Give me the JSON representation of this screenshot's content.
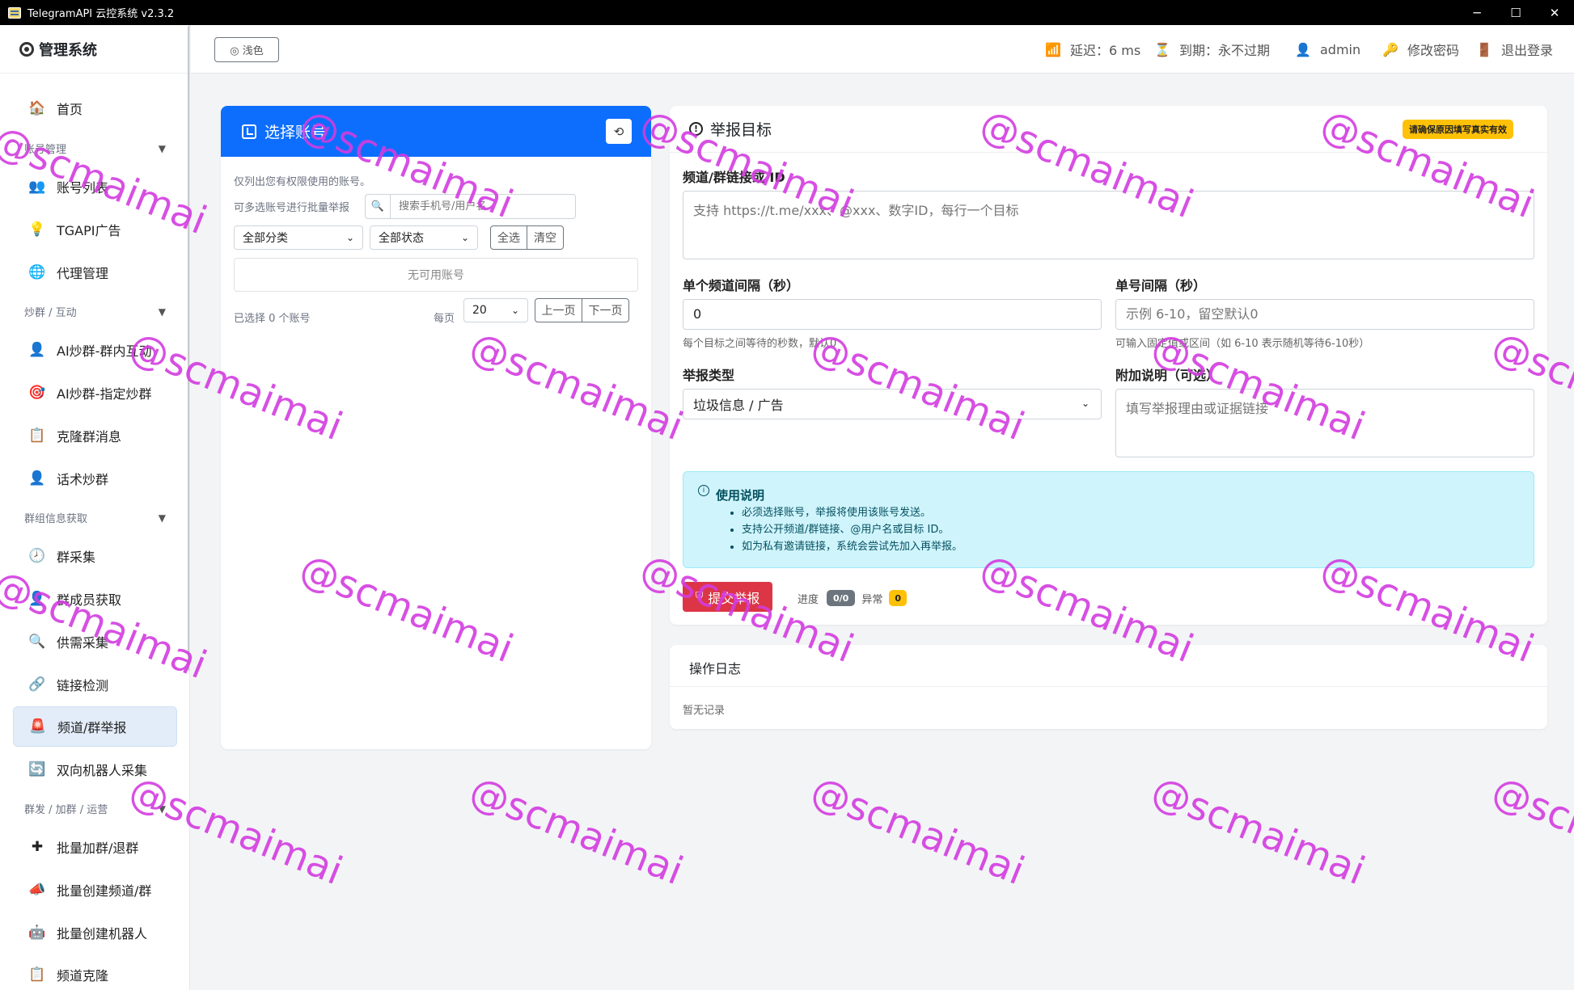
{
  "window": {
    "title": "TelegramAPI 云控系统 v2.3.2",
    "minimize": "─",
    "maximize": "☐",
    "close": "✕"
  },
  "sidebar": {
    "brand": "管理系统",
    "items": [
      {
        "label": "首页",
        "icon": "🏠"
      },
      {
        "label": "账号列表",
        "icon": "👥"
      },
      {
        "label": "TGAPI广告",
        "icon": "💡"
      },
      {
        "label": "代理管理",
        "icon": "🌐"
      },
      {
        "label": "AI炒群-群内互动",
        "icon": "👤"
      },
      {
        "label": "AI炒群-指定炒群",
        "icon": "🎯"
      },
      {
        "label": "克隆群消息",
        "icon": "📋"
      },
      {
        "label": "话术炒群",
        "icon": "👤"
      },
      {
        "label": "群采集",
        "icon": "🕗"
      },
      {
        "label": "群成员获取",
        "icon": "👤"
      },
      {
        "label": "供需采集",
        "icon": "🔍"
      },
      {
        "label": "链接检测",
        "icon": "🔗"
      },
      {
        "label": "频道/群举报",
        "icon": "🚨"
      },
      {
        "label": "双向机器人采集",
        "icon": "🔄"
      },
      {
        "label": "批量加群/退群",
        "icon": "✚"
      },
      {
        "label": "批量创建频道/群",
        "icon": "📣"
      },
      {
        "label": "批量创建机器人",
        "icon": "🤖"
      },
      {
        "label": "频道克隆",
        "icon": "📋"
      }
    ],
    "groups": [
      "账号管理",
      "炒群 / 互动",
      "群组信息获取",
      "群发 / 加群 / 运营"
    ]
  },
  "header": {
    "theme_label": "◎ 浅色",
    "latency": "延迟：6 ms",
    "expire": "到期：永不过期",
    "user": "admin",
    "change_pwd": "修改密码",
    "logout": "退出登录"
  },
  "accounts": {
    "title": "选择账号",
    "refresh": "⟲",
    "desc": "仅列出您有权限使用的账号。",
    "batch_hint": "可多选账号进行批量举报",
    "search_placeholder": "搜索手机号/用户名",
    "category": "全部分类",
    "status": "全部状态",
    "select_all": "全选",
    "clear": "清空",
    "empty": "无可用账号",
    "selected": "已选择 0 个账号",
    "per_page_label": "每页",
    "per_page": "20",
    "prev": "上一页",
    "next": "下一页"
  },
  "report": {
    "title": "举报目标",
    "warning": "请确保原因填写真实有效",
    "target_label": "频道/群链接或 ID",
    "target_placeholder": "支持 https://t.me/xxx、@xxx、数字ID，每行一个目标",
    "interval_label": "单个频道间隔（秒）",
    "interval_value": "0",
    "interval_help": "每个目标之间等待的秒数，默认0",
    "acc_interval_label": "单号间隔（秒）",
    "acc_interval_placeholder": "示例 6-10，留空默认0",
    "acc_interval_help": "可输入固定值或区间（如 6-10 表示随机等待6-10秒）",
    "type_label": "举报类型",
    "type_value": "垃圾信息 / 广告",
    "note_label": "附加说明（可选）",
    "note_placeholder": "填写举报理由或证据链接",
    "usage_title": "使用说明",
    "usage_items": [
      "必须选择账号，举报将使用该账号发送。",
      "支持公开频道/群链接、@用户名或目标 ID。",
      "如为私有邀请链接，系统会尝试先加入再举报。"
    ],
    "submit": "提交举报",
    "progress_label": "进度",
    "progress_value": "0/0",
    "error_label": "异常",
    "error_value": "0"
  },
  "log": {
    "title": "操作日志",
    "empty": "暂无记录"
  },
  "watermark": "@scmaimai",
  "colors": {
    "primary": "#0d6efd",
    "danger": "#dc3545",
    "info_bg": "#cff4fc",
    "warning": "#ffc107",
    "watermark": "#d33ce0"
  }
}
